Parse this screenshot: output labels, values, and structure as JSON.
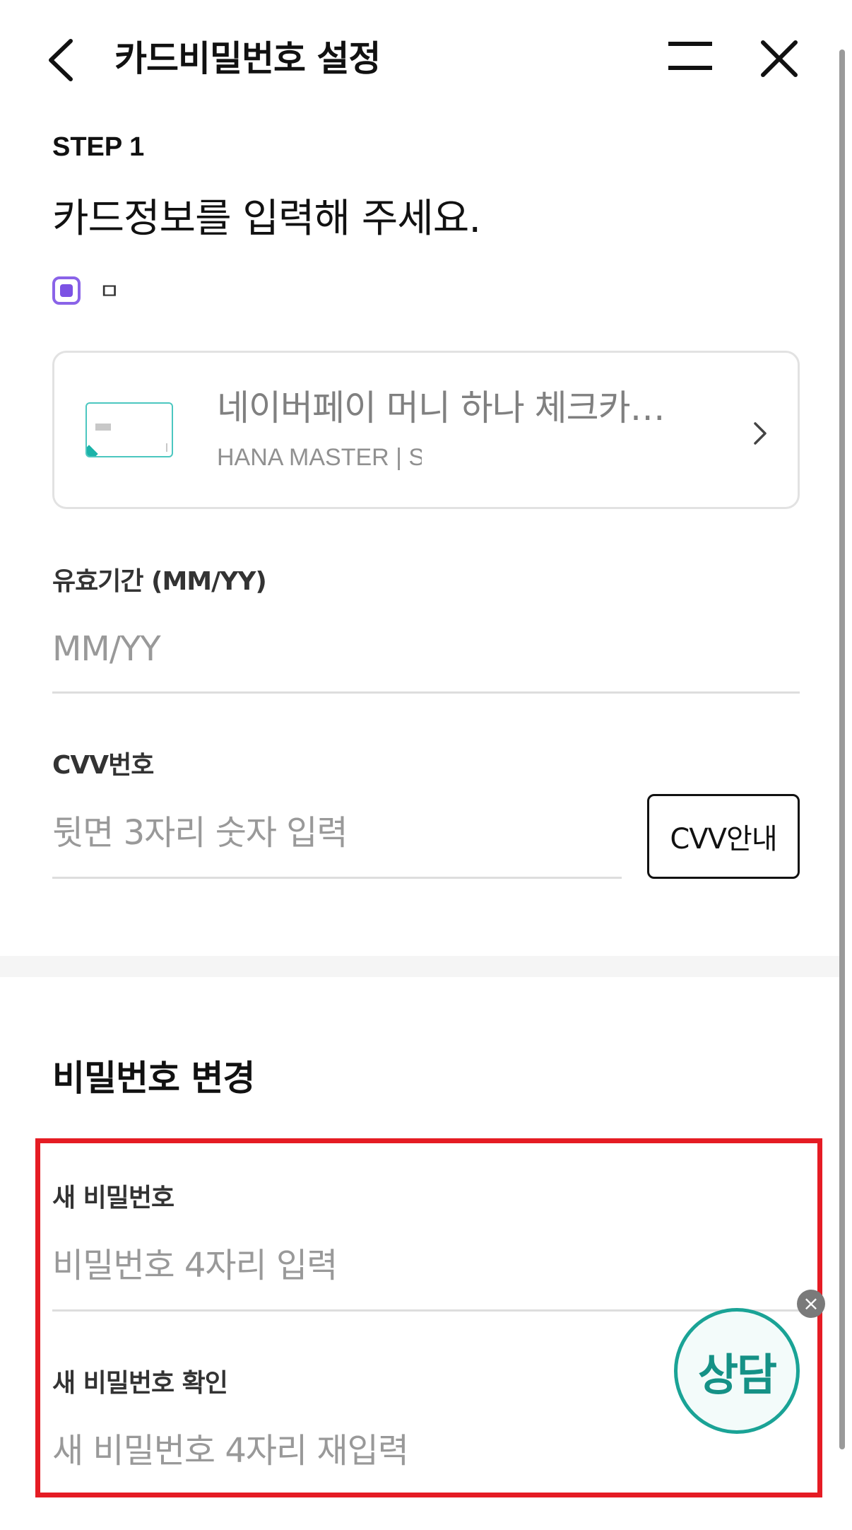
{
  "header": {
    "title": "카드비밀번호 설정",
    "back_icon": "chevron-left-icon",
    "menu_icon": "menu-icon",
    "close_icon": "close-icon"
  },
  "step": {
    "label": "STEP 1",
    "headline": "카드정보를 입력해 주세요."
  },
  "checkbox": {
    "label": "ㅁ",
    "checked": true,
    "color": "#7c52e4"
  },
  "card": {
    "name": "네이버페이 머니 하나 체크카…",
    "subtitle": "HANA MASTER  |  S",
    "arrow_icon": "chevron-right-icon"
  },
  "expiry": {
    "label": "유효기간 (MM/YY)",
    "placeholder": "MM/YY",
    "value": ""
  },
  "cvv": {
    "label": "CVV번호",
    "placeholder": "뒷면 3자리 숫자 입력",
    "value": "",
    "guide_button": "CVV안내"
  },
  "password_section": {
    "title": "비밀번호 변경",
    "new_label": "새 비밀번호",
    "new_placeholder": "비밀번호 4자리 입력",
    "confirm_label": "새 비밀번호 확인",
    "confirm_placeholder": "새 비밀번호 4자리 재입력",
    "highlight_color": "#e51c24"
  },
  "chat": {
    "label": "상담",
    "close_label": "×",
    "accent": "#1aa396"
  }
}
